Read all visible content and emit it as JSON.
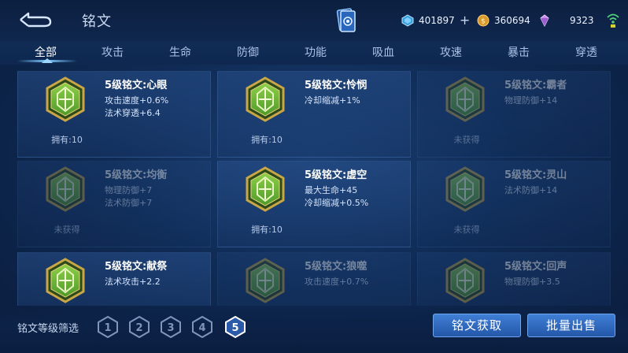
{
  "header": {
    "title": "铭文",
    "currencies": [
      {
        "icon": "diamond-coupon-icon",
        "value": "401897",
        "has_plus": true
      },
      {
        "icon": "gold-coin-icon",
        "value": "360694",
        "has_plus": false
      },
      {
        "icon": "gem-icon",
        "value": "9323",
        "has_plus": false
      }
    ]
  },
  "tabs": [
    {
      "label": "全部",
      "active": true
    },
    {
      "label": "攻击"
    },
    {
      "label": "生命"
    },
    {
      "label": "防御"
    },
    {
      "label": "功能"
    },
    {
      "label": "吸血"
    },
    {
      "label": "攻速"
    },
    {
      "label": "暴击"
    },
    {
      "label": "穿透"
    }
  ],
  "inscriptions": [
    {
      "name": "5级铭文:心眼",
      "attrs": [
        "攻击速度+0.6%",
        "法术穿透+6.4"
      ],
      "status": "拥有:10",
      "locked": false,
      "color": "green"
    },
    {
      "name": "5级铭文:怜悯",
      "attrs": [
        "冷却缩减+1%"
      ],
      "status": "拥有:10",
      "locked": false,
      "color": "green"
    },
    {
      "name": "5级铭文:霸者",
      "attrs": [
        "物理防御+14"
      ],
      "status": "未获得",
      "locked": true,
      "color": "green"
    },
    {
      "name": "5级铭文:均衡",
      "attrs": [
        "物理防御+7",
        "法术防御+7"
      ],
      "status": "未获得",
      "locked": true,
      "color": "green"
    },
    {
      "name": "5级铭文:虚空",
      "attrs": [
        "最大生命+45",
        "冷却缩减+0.5%"
      ],
      "status": "拥有:10",
      "locked": false,
      "color": "green"
    },
    {
      "name": "5级铭文:灵山",
      "attrs": [
        "法术防御+14"
      ],
      "status": "未获得",
      "locked": true,
      "color": "green"
    },
    {
      "name": "5级铭文:献祭",
      "attrs": [
        "法术攻击+2.2"
      ],
      "status": "",
      "locked": false,
      "color": "green"
    },
    {
      "name": "5级铭文:狼噬",
      "attrs": [
        "攻击速度+0.7%"
      ],
      "status": "",
      "locked": true,
      "color": "green"
    },
    {
      "name": "5级铭文:回声",
      "attrs": [
        "物理防御+3.5"
      ],
      "status": "",
      "locked": true,
      "color": "green"
    }
  ],
  "footer": {
    "filter_label": "铭文等级筛选",
    "levels": [
      {
        "label": "1",
        "selected": false
      },
      {
        "label": "2",
        "selected": false
      },
      {
        "label": "3",
        "selected": false
      },
      {
        "label": "4",
        "selected": false
      },
      {
        "label": "5",
        "selected": true
      }
    ],
    "acquire_label": "铭文获取",
    "sell_label": "批量出售"
  },
  "colors": {
    "accent": "#3f7fd6",
    "badge_green": "#4f9a2a",
    "badge_gold": "#c9a646",
    "selected_level": "#ffffff"
  }
}
